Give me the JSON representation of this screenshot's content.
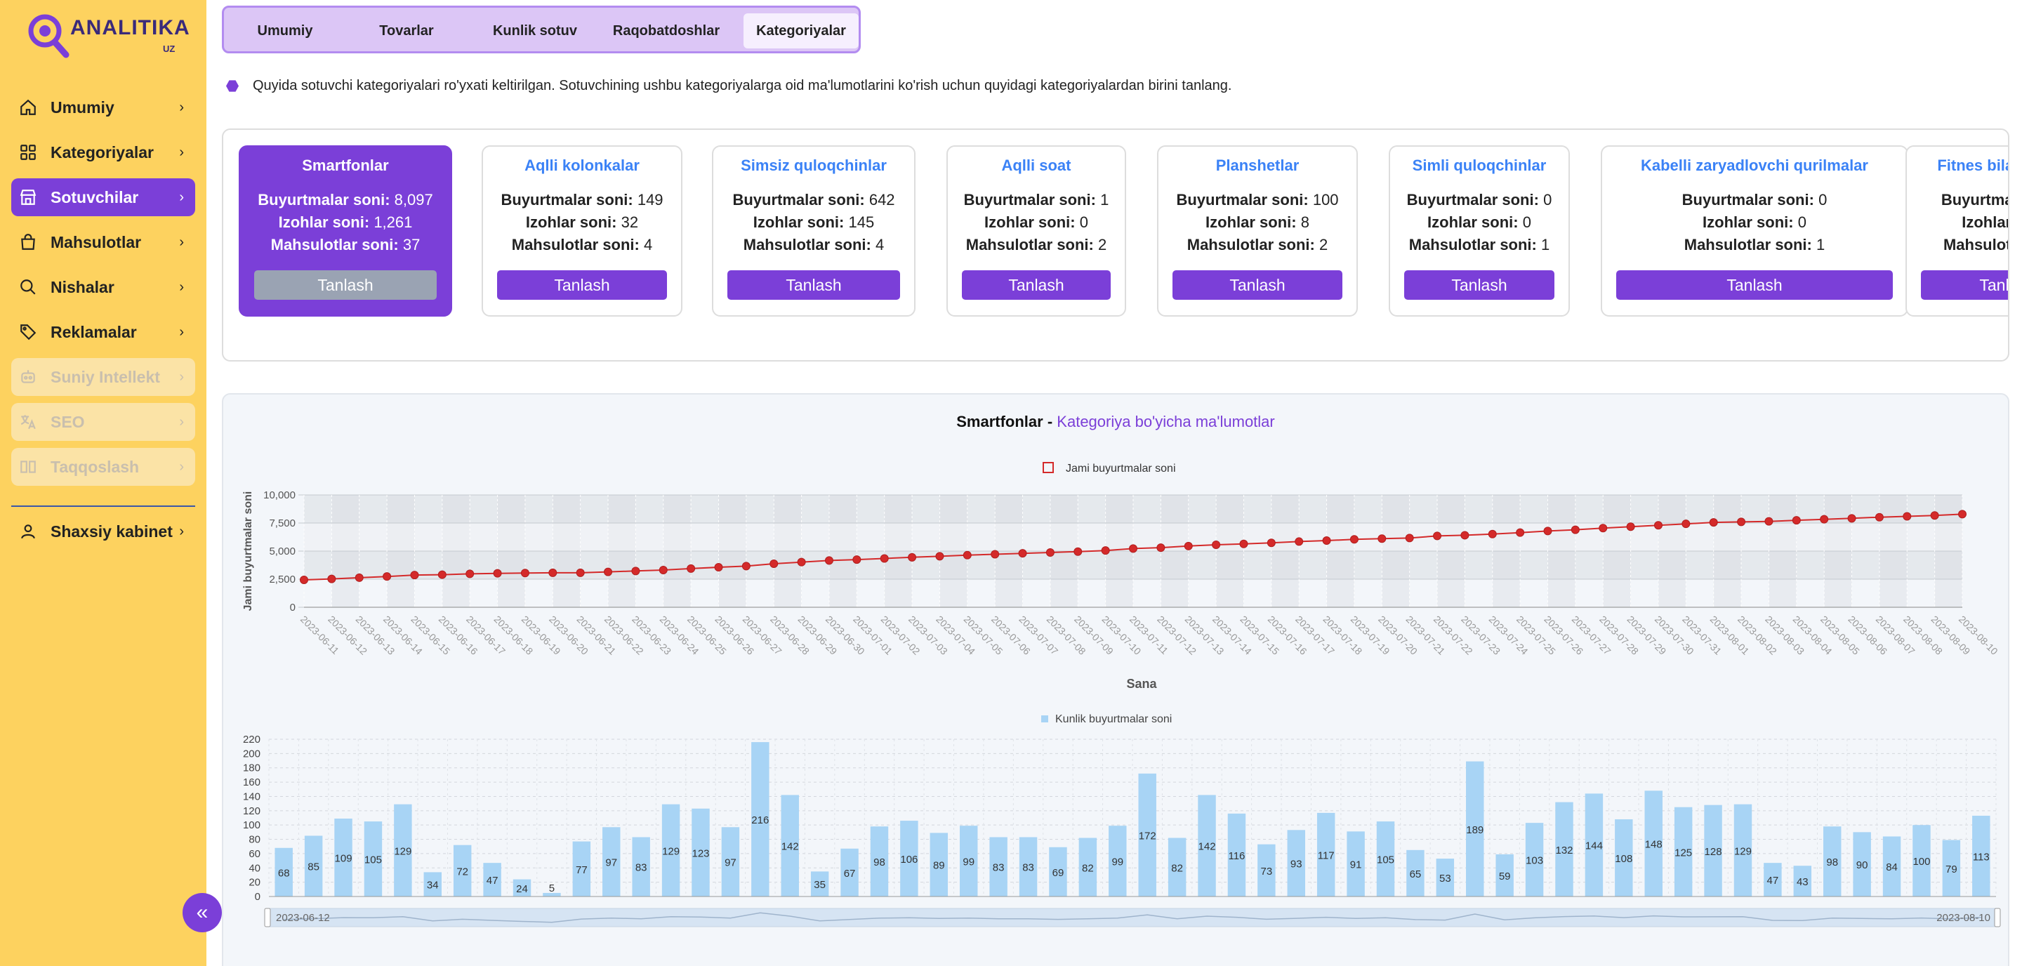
{
  "brand": {
    "name": "ANALITIKA",
    "suffix": "UZ"
  },
  "sidebar": {
    "items": [
      {
        "label": "Umumiy",
        "icon": "home-icon",
        "state": "normal"
      },
      {
        "label": "Kategoriyalar",
        "icon": "grid-icon",
        "state": "normal"
      },
      {
        "label": "Sotuvchilar",
        "icon": "store-icon",
        "state": "active"
      },
      {
        "label": "Mahsulotlar",
        "icon": "bag-icon",
        "state": "normal"
      },
      {
        "label": "Nishalar",
        "icon": "search-icon",
        "state": "normal"
      },
      {
        "label": "Reklamalar",
        "icon": "tag-icon",
        "state": "normal"
      },
      {
        "label": "Suniy Intellekt",
        "icon": "robot-icon",
        "state": "disabled"
      },
      {
        "label": "SEO",
        "icon": "translate-icon",
        "state": "disabled"
      },
      {
        "label": "Taqqoslash",
        "icon": "compare-icon",
        "state": "disabled"
      }
    ],
    "account": {
      "label": "Shaxsiy kabinet",
      "icon": "user-icon"
    }
  },
  "tabs": [
    "Umumiy",
    "Tovarlar",
    "Kunlik sotuv",
    "Raqobatdoshlar",
    "Kategoriyalar"
  ],
  "active_tab": "Kategoriyalar",
  "info_text": "Quyida sotuvchi kategoriyalari ro'yxati keltirilgan. Sotuvchining ushbu kategoriyalarga oid ma'lumotlarini ko'rish uchun quyidagi kategoriyalardan birini tanlang.",
  "labels": {
    "orders": "Buyurtmalar soni:",
    "reviews": "Izohlar soni:",
    "products": "Mahsulotlar soni:",
    "select": "Tanlash"
  },
  "categories": [
    {
      "name": "Smartfonlar",
      "orders": "8,097",
      "reviews": "1,261",
      "products": "37",
      "selected": true
    },
    {
      "name": "Aqlli kolonkalar",
      "orders": "149",
      "reviews": "32",
      "products": "4",
      "selected": false
    },
    {
      "name": "Simsiz quloqchinlar",
      "orders": "642",
      "reviews": "145",
      "products": "4",
      "selected": false
    },
    {
      "name": "Aqlli soat",
      "orders": "1",
      "reviews": "0",
      "products": "2",
      "selected": false
    },
    {
      "name": "Planshetlar",
      "orders": "100",
      "reviews": "8",
      "products": "2",
      "selected": false
    },
    {
      "name": "Simli quloqchinlar",
      "orders": "0",
      "reviews": "0",
      "products": "1",
      "selected": false
    },
    {
      "name": "Kabelli zaryadlovchi qurilmalar",
      "orders": "0",
      "reviews": "0",
      "products": "1",
      "selected": false
    },
    {
      "name": "Fitnes bilaguzuklar",
      "orders": "",
      "reviews": "",
      "products": "",
      "selected": false
    }
  ],
  "panel": {
    "title_bold": "Smartfonlar -",
    "title_sub": "Kategoriya bo'yicha ma'lumotlar"
  },
  "colors": {
    "accent": "#7b3fd8",
    "line": "#d42a2a",
    "bar": "#a8d4f5",
    "sidebar": "#fdd25f",
    "link": "#3b82f6"
  },
  "chart_data": [
    {
      "type": "line",
      "legend": "Jami buyurtmalar soni",
      "legend_position": "top-center",
      "xlabel": "Sana",
      "ylabel": "Jami buyurtmalar soni",
      "ylim": [
        0,
        10000
      ],
      "yticks": [
        "0",
        "2,500",
        "5,000",
        "7,500",
        "10,000"
      ],
      "x": [
        "2023-06-11",
        "2023-06-12",
        "2023-06-13",
        "2023-06-14",
        "2023-06-15",
        "2023-06-16",
        "2023-06-17",
        "2023-06-18",
        "2023-06-19",
        "2023-06-20",
        "2023-06-21",
        "2023-06-22",
        "2023-06-23",
        "2023-06-24",
        "2023-06-25",
        "2023-06-26",
        "2023-06-27",
        "2023-06-28",
        "2023-06-29",
        "2023-06-30",
        "2023-07-01",
        "2023-07-02",
        "2023-07-03",
        "2023-07-04",
        "2023-07-05",
        "2023-07-06",
        "2023-07-07",
        "2023-07-08",
        "2023-07-09",
        "2023-07-10",
        "2023-07-11",
        "2023-07-12",
        "2023-07-13",
        "2023-07-14",
        "2023-07-15",
        "2023-07-16",
        "2023-07-17",
        "2023-07-18",
        "2023-07-19",
        "2023-07-20",
        "2023-07-21",
        "2023-07-22",
        "2023-07-23",
        "2023-07-24",
        "2023-07-25",
        "2023-07-26",
        "2023-07-27",
        "2023-07-28",
        "2023-07-29",
        "2023-07-30",
        "2023-07-31",
        "2023-08-01",
        "2023-08-02",
        "2023-08-03",
        "2023-08-04",
        "2023-08-05",
        "2023-08-06",
        "2023-08-07",
        "2023-08-08",
        "2023-08-09",
        "2023-08-10"
      ],
      "values": [
        2440,
        2525,
        2634,
        2739,
        2868,
        2902,
        2974,
        3021,
        3045,
        3070,
        3070,
        3147,
        3230,
        3313,
        3442,
        3565,
        3662,
        3878,
        4020,
        4162,
        4244,
        4342,
        4448,
        4538,
        4637,
        4720,
        4803,
        4872,
        4954,
        5053,
        5225,
        5307,
        5449,
        5565,
        5638,
        5731,
        5848,
        5939,
        6044,
        6109,
        6162,
        6351,
        6410,
        6513,
        6645,
        6789,
        6897,
        7045,
        7170,
        7298,
        7426,
        7555,
        7602,
        7645,
        7743,
        7833,
        7917,
        8017,
        8096,
        8175,
        8288
      ]
    },
    {
      "type": "bar",
      "legend": "Kunlik buyurtmalar soni",
      "legend_position": "top-center",
      "ylim": [
        0,
        220
      ],
      "yticks": [
        "0",
        "20",
        "40",
        "60",
        "80",
        "100",
        "120",
        "140",
        "160",
        "180",
        "200",
        "220"
      ],
      "range_labels": [
        "2023-06-12",
        "2023-08-10"
      ],
      "values": [
        68,
        85,
        109,
        105,
        129,
        34,
        72,
        47,
        24,
        5,
        77,
        97,
        83,
        129,
        123,
        97,
        216,
        142,
        35,
        67,
        98,
        106,
        89,
        99,
        83,
        83,
        69,
        82,
        99,
        172,
        82,
        142,
        116,
        73,
        93,
        117,
        91,
        105,
        65,
        53,
        189,
        59,
        103,
        132,
        144,
        108,
        148,
        125,
        128,
        129,
        47,
        43,
        98,
        90,
        84,
        100,
        79,
        113
      ],
      "labels": [
        "68",
        "85",
        "109",
        "105",
        "129",
        "34",
        "72",
        "47",
        "24",
        "5",
        "77",
        "97",
        "83",
        "129",
        "123",
        "97",
        "216",
        "142",
        "35",
        "67",
        "98",
        "106",
        "89",
        "99",
        "83",
        "83",
        "69",
        "82",
        "99",
        "172",
        "82",
        "142",
        "116",
        "73",
        "93",
        "117",
        "91",
        "105",
        "65",
        "53",
        "189",
        "59",
        "103",
        "132",
        "144",
        "108",
        "148",
        "125",
        "128",
        "129",
        "47",
        "43",
        "98",
        "90",
        "84",
        "100",
        "79",
        "113"
      ]
    }
  ]
}
